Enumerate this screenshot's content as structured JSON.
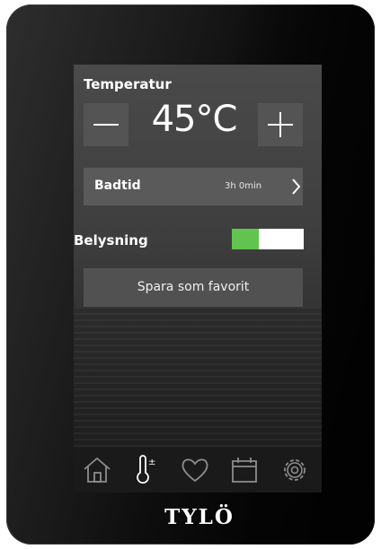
{
  "temperature": {
    "label": "Temperatur",
    "value": "45°C",
    "decrease_symbol": "minus-icon",
    "increase_symbol": "plus-icon"
  },
  "bath_time": {
    "label": "Badtid",
    "value": "3h 0min"
  },
  "lighting": {
    "label": "Belysning",
    "on": true,
    "on_color": "#62c350"
  },
  "favorite_button": {
    "label": "Spara som favorit"
  },
  "nav": {
    "items": [
      "home-icon",
      "thermometer-icon",
      "heart-icon",
      "calendar-icon",
      "settings-icon"
    ],
    "active": "thermometer-icon"
  },
  "brand": {
    "logo_text": "TYLÖ"
  }
}
